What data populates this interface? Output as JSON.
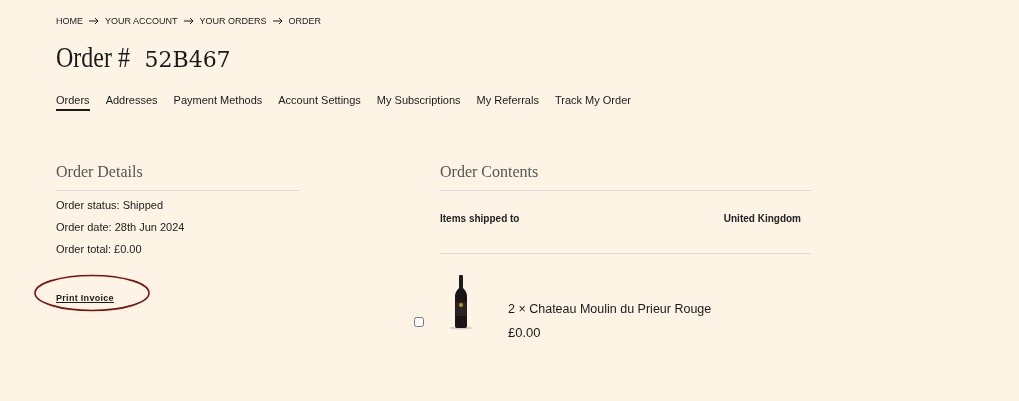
{
  "breadcrumb": [
    "HOME",
    "YOUR ACCOUNT",
    "YOUR ORDERS",
    "ORDER"
  ],
  "title": "Order #",
  "order_number": "52B467",
  "tabs": [
    {
      "label": "Orders",
      "selected": true
    },
    {
      "label": "Addresses",
      "selected": false
    },
    {
      "label": "Payment Methods",
      "selected": false
    },
    {
      "label": "Account Settings",
      "selected": false
    },
    {
      "label": "My Subscriptions",
      "selected": false
    },
    {
      "label": "My Referrals",
      "selected": false
    },
    {
      "label": "Track My Order",
      "selected": false
    }
  ],
  "details": {
    "heading": "Order Details",
    "lines": [
      "Order status: Shipped",
      "Order date: 28th Jun 2024",
      "Order total: £0.00"
    ],
    "print_invoice": {
      "label": "Print Invoice",
      "annotated": true
    }
  },
  "contents": {
    "heading": "Order Contents",
    "shipped_label": "Items shipped to",
    "shipped_to": "United Kingdom",
    "items": [
      {
        "checked": false,
        "kind": "picture",
        "name": "2 × Chateau Moulin du Prieur Rouge",
        "price": "£0.00"
      }
    ]
  }
}
